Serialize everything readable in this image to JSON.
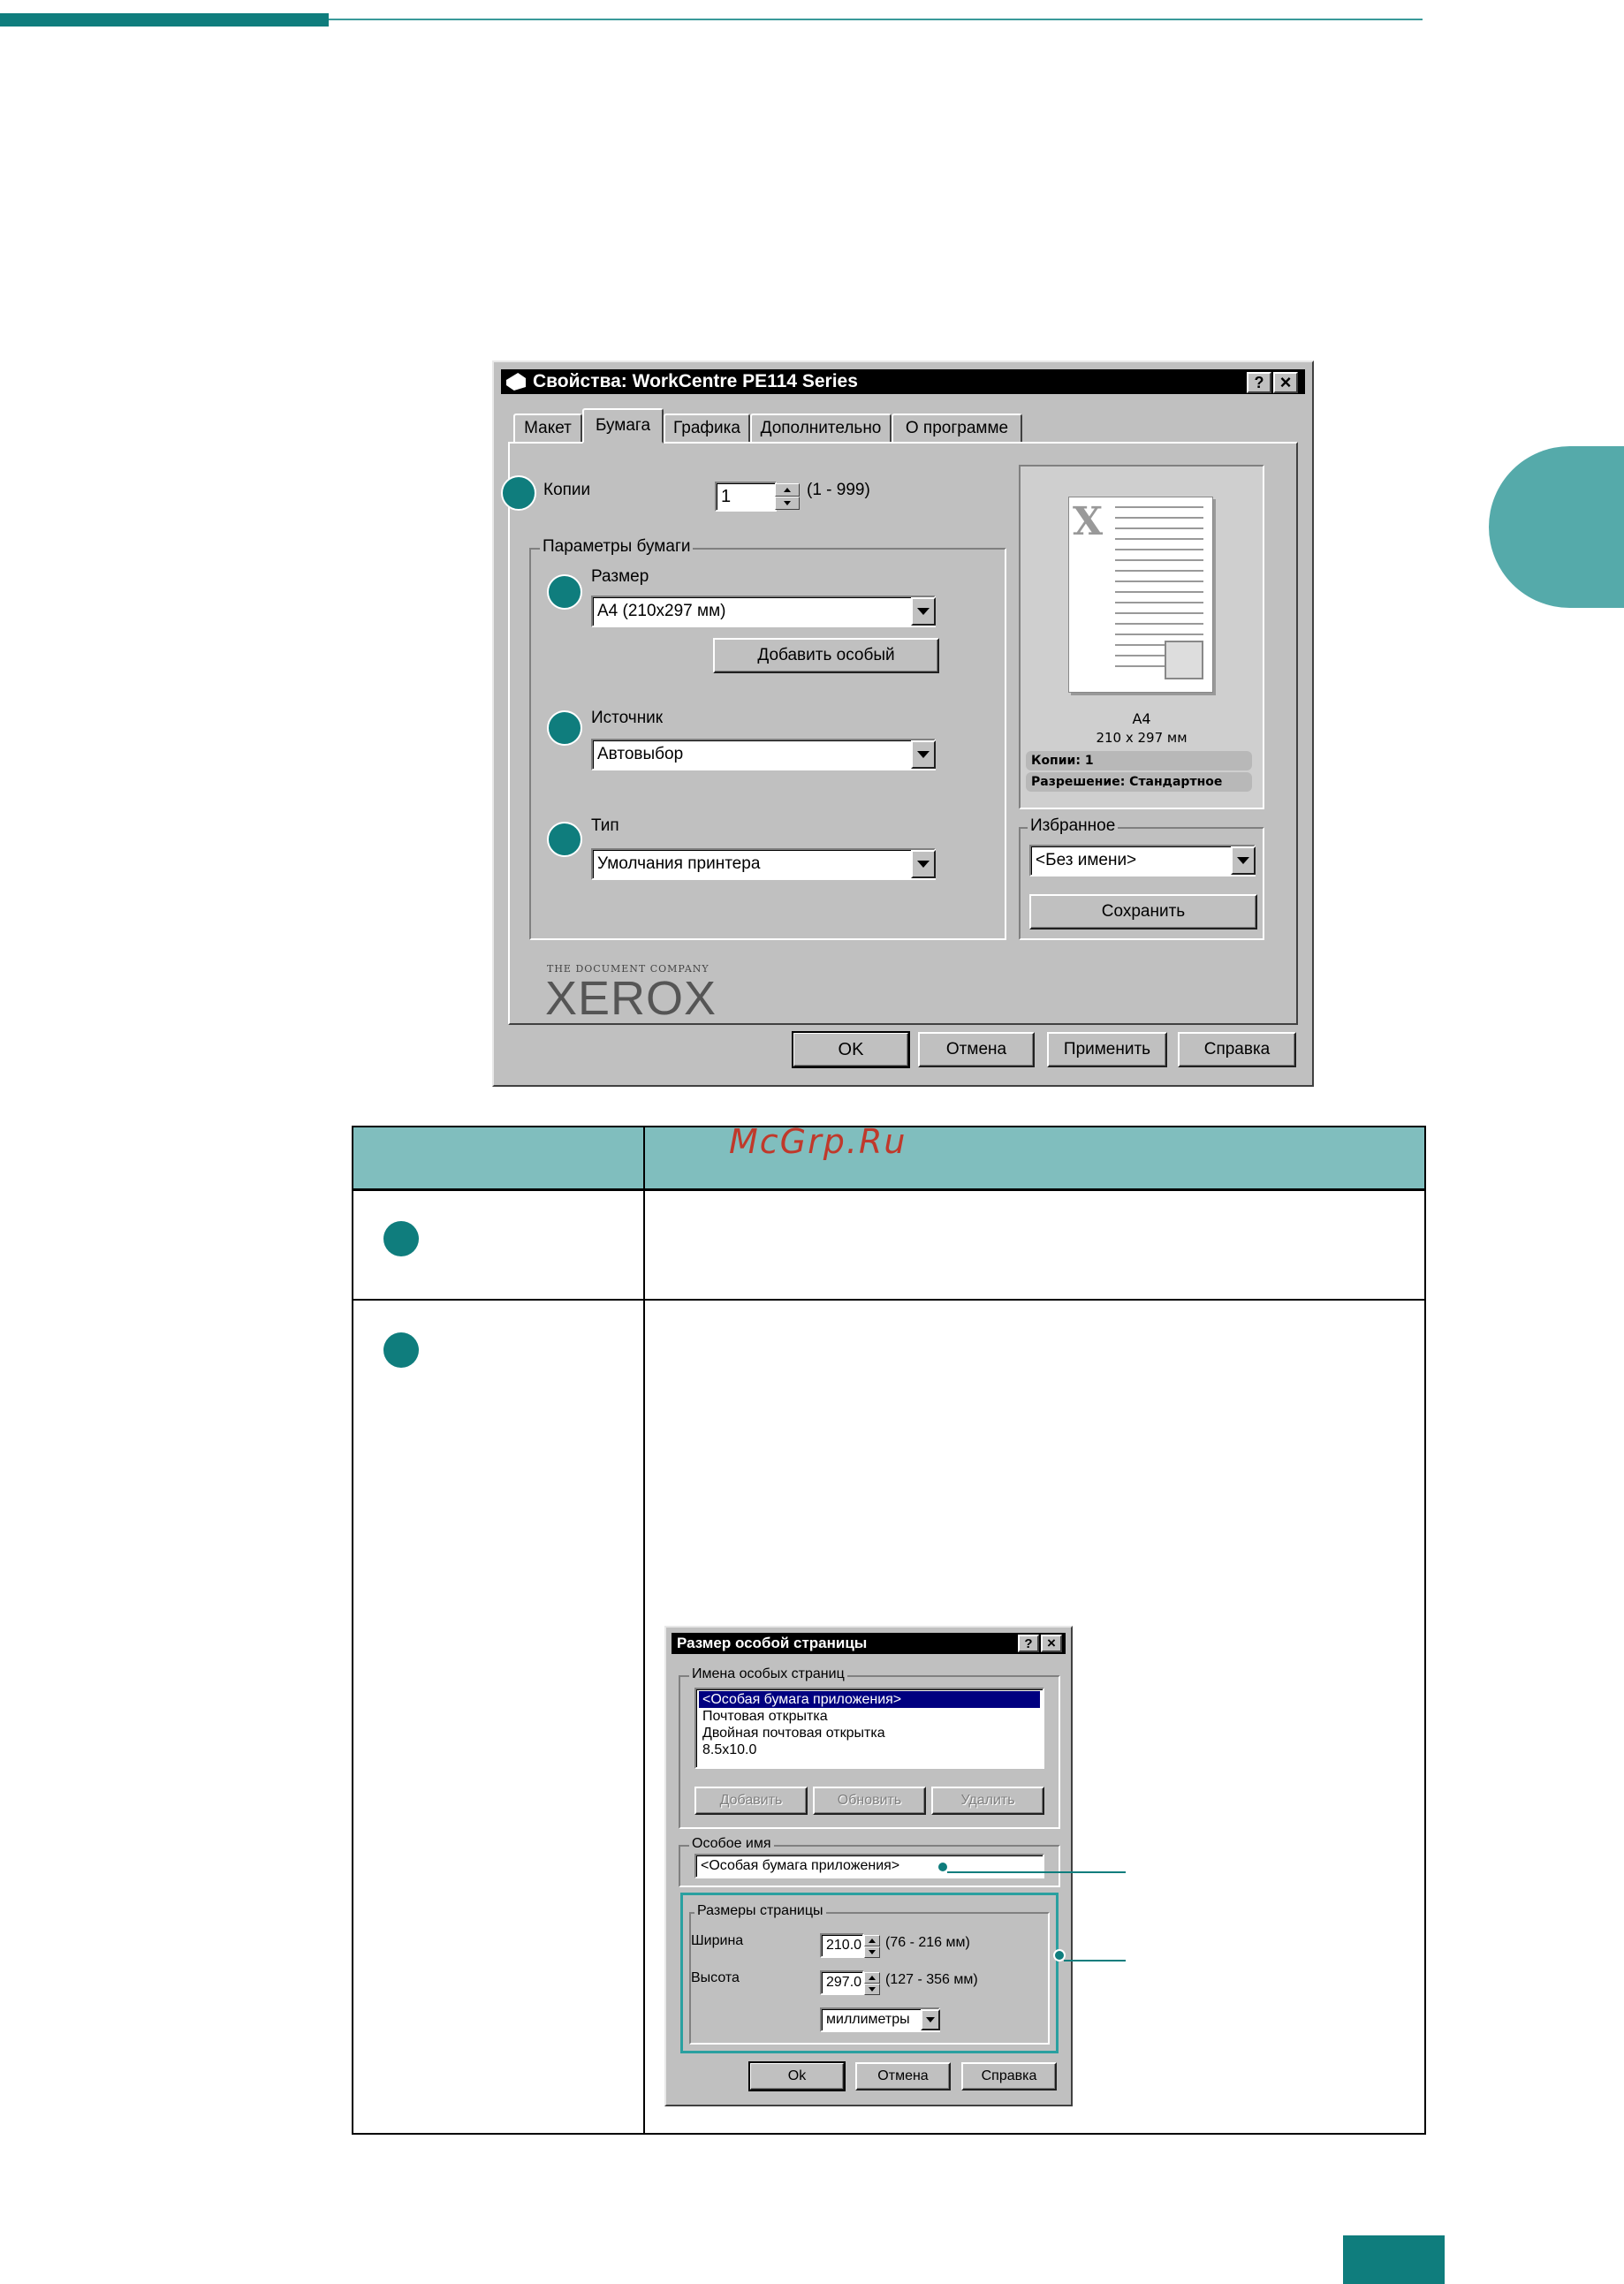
{
  "dialog": {
    "title": "Свойства: WorkCentre PE114 Series",
    "help_btn": "?",
    "close_btn": "×",
    "tabs": [
      "Макет",
      "Бумага",
      "Графика",
      "Дополнительно",
      "О программе"
    ],
    "copies_label": "Копии",
    "copies_value": "1",
    "copies_range": "(1 - 999)",
    "paper_group": "Параметры бумаги",
    "size_label": "Размер",
    "size_value": "A4 (210x297 мм)",
    "add_custom": "Добавить особый",
    "source_label": "Источник",
    "source_value": "Автовыбор",
    "type_label": "Тип",
    "type_value": "Умолчания принтера",
    "preview": {
      "paper": "A4",
      "dims": "210 x 297 мм",
      "copies": "Копии: 1",
      "resolution": "Разрешение: Стандартное"
    },
    "favorites_group": "Избранное",
    "favorites_value": "<Без имени>",
    "save_btn": "Сохранить",
    "brand_small": "THE DOCUMENT COMPANY",
    "brand": "XEROX",
    "ok_btn": "OK",
    "cancel_btn": "Отмена",
    "apply_btn": "Применить",
    "help_btn2": "Справка"
  },
  "watermark": "McGrp.Ru",
  "custom_dialog": {
    "title": "Размер особой страницы",
    "help_btn": "?",
    "close_btn": "×",
    "names_group": "Имена особых страниц",
    "items": [
      "<Особая бумага приложения>",
      "Почтовая открытка",
      "Двойная почтовая открытка",
      "8.5x10.0"
    ],
    "add_btn": "Добавить",
    "update_btn": "Обновить",
    "delete_btn": "Удалить",
    "custom_name_group": "Особое имя",
    "custom_name_value": "<Особая бумага приложения>",
    "sizes_group": "Размеры страницы",
    "width_label": "Ширина",
    "width_value": "210.0",
    "width_range": "(76 - 216 мм)",
    "height_label": "Высота",
    "height_value": "297.0",
    "height_range": "(127 - 356 мм)",
    "units_value": "миллиметры",
    "ok_btn": "Ok",
    "cancel_btn": "Отмена",
    "help_btn2": "Справка"
  },
  "colors": {
    "accent": "#0f7d7d",
    "header_fill": "#80bebe",
    "tab_fill": "#55aaaa"
  }
}
